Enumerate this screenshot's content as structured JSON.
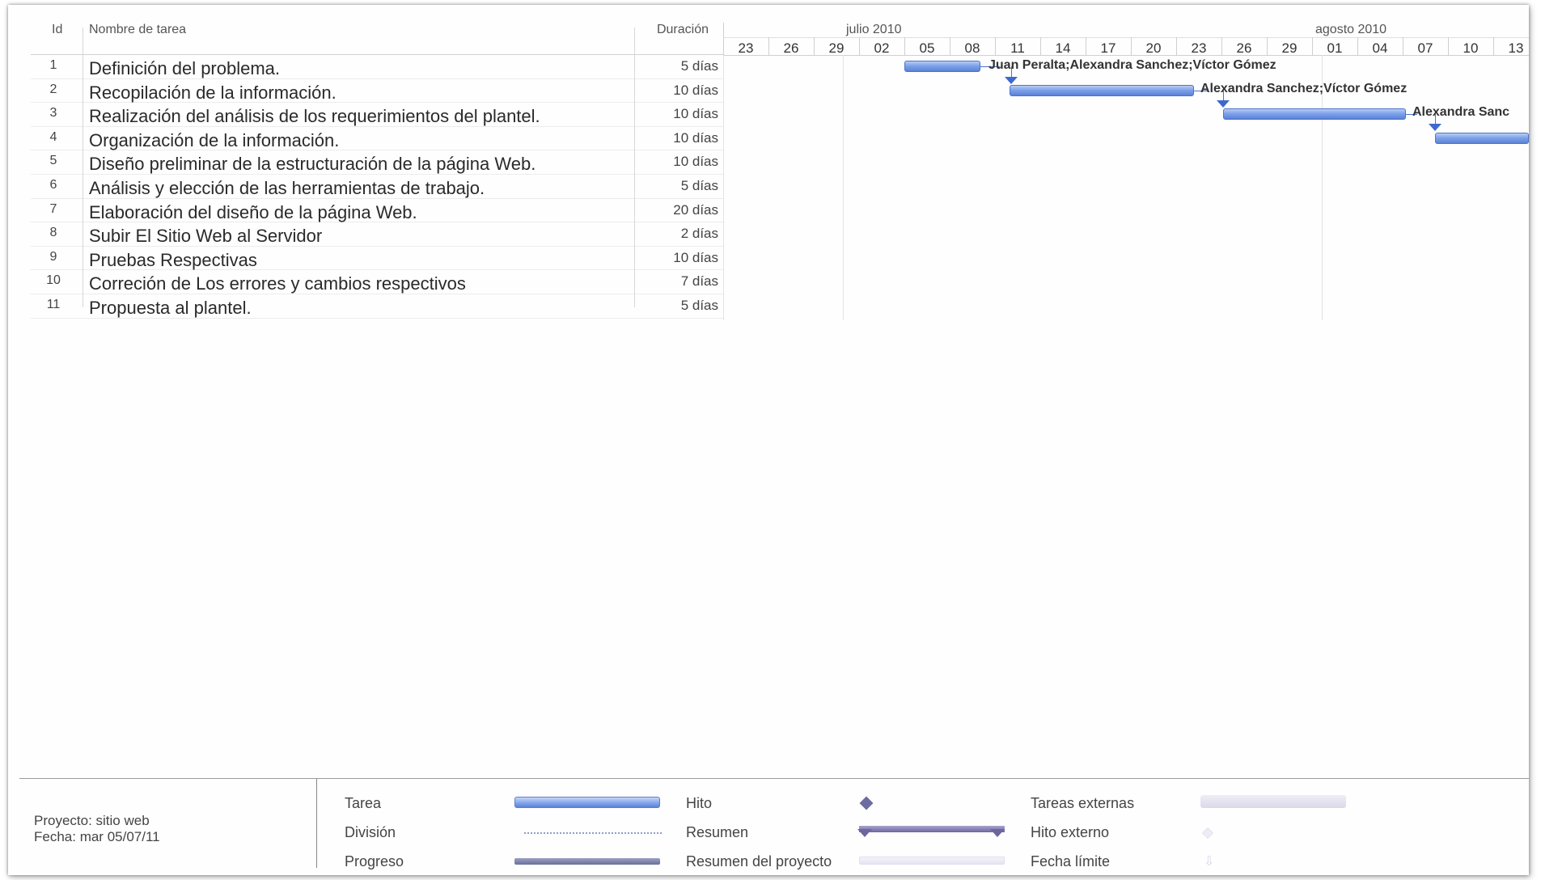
{
  "table": {
    "headers": {
      "id": "Id",
      "name": "Nombre de tarea",
      "duration": "Duración"
    },
    "rows": [
      {
        "id": "1",
        "name": "Definición del problema.",
        "duration": "5 días"
      },
      {
        "id": "2",
        "name": "Recopilación de la información.",
        "duration": "10 días"
      },
      {
        "id": "3",
        "name": "Realización del análisis de los requerimientos del plantel.",
        "duration": "10 días"
      },
      {
        "id": "4",
        "name": "Organización de la información.",
        "duration": "10 días"
      },
      {
        "id": "5",
        "name": "Diseño preliminar de la estructuración de la página Web.",
        "duration": "10 días"
      },
      {
        "id": "6",
        "name": "Análisis y elección de las herramientas de trabajo.",
        "duration": "5 días"
      },
      {
        "id": "7",
        "name": "Elaboración del diseño de la página Web.",
        "duration": "20 días"
      },
      {
        "id": "8",
        "name": "Subir El Sitio Web al Servidor",
        "duration": "2 días"
      },
      {
        "id": "9",
        "name": "Pruebas Respectivas",
        "duration": "10 días"
      },
      {
        "id": "10",
        "name": "Correción de Los errores y cambios respectivos",
        "duration": "7 días"
      },
      {
        "id": "11",
        "name": "Propuesta al plantel.",
        "duration": "5 días"
      }
    ]
  },
  "gantt": {
    "months": [
      "julio 2010",
      "agosto 2010"
    ],
    "days": [
      "23",
      "26",
      "29",
      "02",
      "05",
      "08",
      "11",
      "14",
      "17",
      "20",
      "23",
      "26",
      "29",
      "01",
      "04",
      "07",
      "10",
      "13"
    ],
    "resources": [
      "Juan Peralta;Alexandra Sanchez;Víctor Gómez",
      "Alexandra Sanchez;Víctor Gómez",
      "Alexandra Sanc"
    ],
    "bar_color": "#7ea2ea"
  },
  "legend": {
    "project": "Proyecto: sitio web",
    "date": "Fecha: mar 05/07/11",
    "items": {
      "tarea": "Tarea",
      "division": "División",
      "progreso": "Progreso",
      "hito": "Hito",
      "resumen": "Resumen",
      "resumen_proyecto": "Resumen del proyecto",
      "tareas_externas": "Tareas externas",
      "hito_externo": "Hito externo",
      "fecha_limite": "Fecha límite"
    }
  }
}
